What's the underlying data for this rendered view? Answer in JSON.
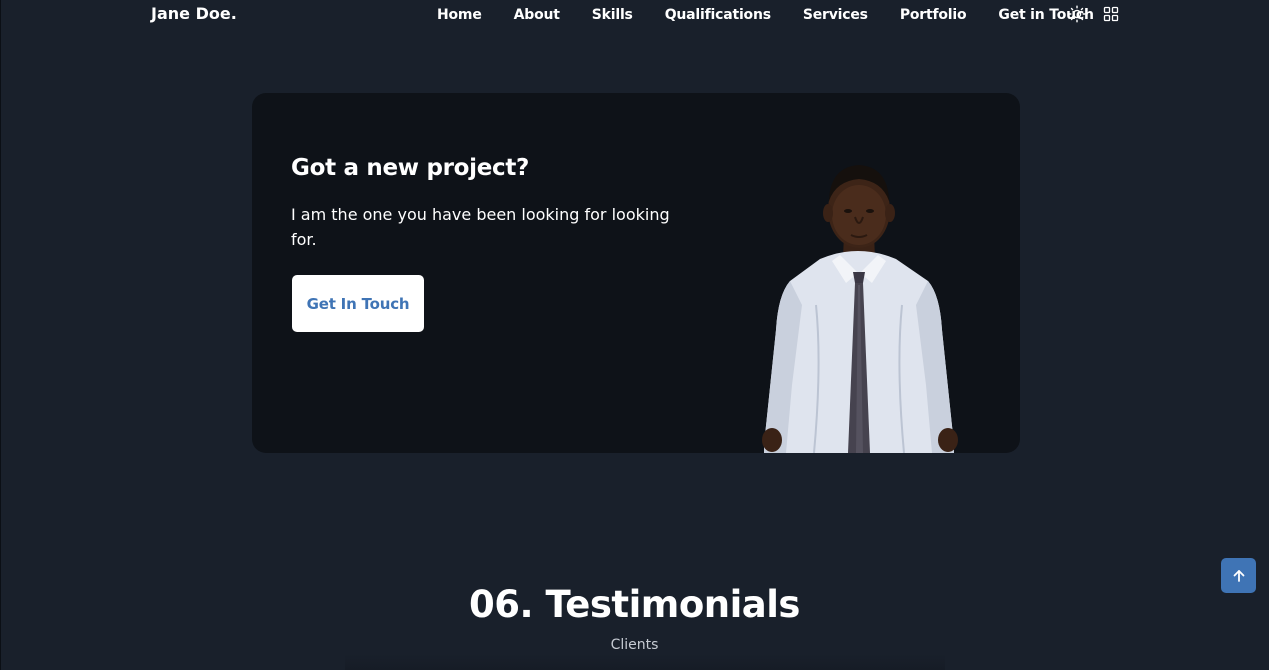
{
  "header": {
    "brand": "Jane Doe.",
    "nav": [
      {
        "label": "Home"
      },
      {
        "label": "About"
      },
      {
        "label": "Skills"
      },
      {
        "label": "Qualifications"
      },
      {
        "label": "Services"
      },
      {
        "label": "Portfolio"
      },
      {
        "label": "Get in Touch"
      }
    ],
    "icons": {
      "theme_toggle": "sun-icon",
      "menu": "grid-icon"
    }
  },
  "project": {
    "title": "Got a new project?",
    "text": "I am the one you have been looking for looking for.",
    "button": "Get In Touch",
    "image": "portrait-photo"
  },
  "testimonials": {
    "title": "06. Testimonials",
    "subtitle": "Clients"
  },
  "scroll_up": {
    "icon": "arrow-up-icon"
  },
  "colors": {
    "background": "#19202b",
    "card": "#0e1218",
    "accent": "#3f74b5",
    "text": "#ffffff",
    "muted": "#c6cbd3"
  }
}
